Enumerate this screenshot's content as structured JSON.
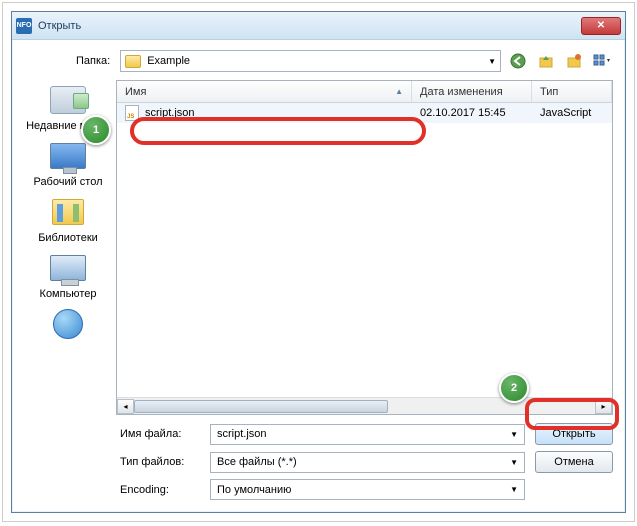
{
  "window": {
    "title": "Открыть"
  },
  "top": {
    "folder_label": "Папка:",
    "folder_name": "Example"
  },
  "places": {
    "recent": "Недавние места",
    "desktop": "Рабочий стол",
    "libraries": "Библиотеки",
    "computer": "Компьютер",
    "network": ""
  },
  "columns": {
    "name": "Имя",
    "date": "Дата изменения",
    "type": "Тип"
  },
  "files": [
    {
      "name": "script.json",
      "date": "02.10.2017 15:45",
      "type": "JavaScript"
    }
  ],
  "bottom": {
    "filename_label": "Имя файла:",
    "filename_value": "script.json",
    "filetype_label": "Тип файлов:",
    "filetype_value": "Все файлы (*.*)",
    "encoding_label": "Encoding:",
    "encoding_value": "По умолчанию",
    "open": "Открыть",
    "cancel": "Отмена"
  },
  "annotations": {
    "step1": "1",
    "step2": "2"
  }
}
